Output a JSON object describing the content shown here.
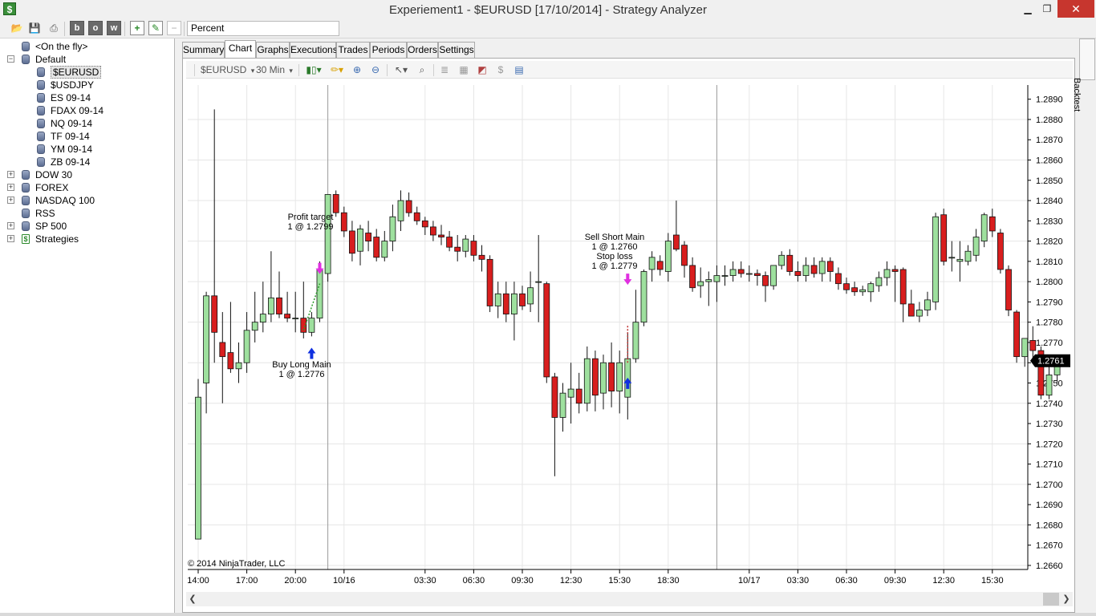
{
  "window": {
    "title": "Experiement1 - $EURUSD [17/10/2014] - Strategy Analyzer",
    "min": "▁",
    "max": "❐",
    "close": "✕"
  },
  "toolbar": {
    "metric": "Percent",
    "icons": [
      "open-folder-icon",
      "save-icon",
      "print-icon",
      "b-icon",
      "o-icon",
      "w-icon",
      "add-icon",
      "edit-icon",
      "remove-icon"
    ],
    "b_label": "b",
    "o_label": "o",
    "w_label": "w"
  },
  "tree": {
    "items": [
      {
        "label": "<On the fly>",
        "level": 1,
        "expander": "",
        "icon": "db"
      },
      {
        "label": "Default",
        "level": 0,
        "expander": "−",
        "icon": "db"
      },
      {
        "label": "$EURUSD",
        "level": 2,
        "expander": "",
        "icon": "db",
        "selected": true
      },
      {
        "label": "$USDJPY",
        "level": 2,
        "expander": "",
        "icon": "db"
      },
      {
        "label": "ES 09-14",
        "level": 2,
        "expander": "",
        "icon": "db"
      },
      {
        "label": "FDAX 09-14",
        "level": 2,
        "expander": "",
        "icon": "db"
      },
      {
        "label": "NQ 09-14",
        "level": 2,
        "expander": "",
        "icon": "db"
      },
      {
        "label": "TF 09-14",
        "level": 2,
        "expander": "",
        "icon": "db"
      },
      {
        "label": "YM 09-14",
        "level": 2,
        "expander": "",
        "icon": "db"
      },
      {
        "label": "ZB 09-14",
        "level": 2,
        "expander": "",
        "icon": "db"
      },
      {
        "label": "DOW 30",
        "level": 0,
        "expander": "+",
        "icon": "db"
      },
      {
        "label": "FOREX",
        "level": 0,
        "expander": "+",
        "icon": "db"
      },
      {
        "label": "NASDAQ 100",
        "level": 0,
        "expander": "+",
        "icon": "db"
      },
      {
        "label": "RSS",
        "level": 1,
        "expander": "",
        "icon": "db"
      },
      {
        "label": "SP 500",
        "level": 0,
        "expander": "+",
        "icon": "db"
      },
      {
        "label": "Strategies",
        "level": 0,
        "expander": "+",
        "icon": "strategy"
      }
    ]
  },
  "tabs": [
    {
      "label": "Summary"
    },
    {
      "label": "Chart",
      "active": true
    },
    {
      "label": "Graphs"
    },
    {
      "label": "Executions"
    },
    {
      "label": "Trades"
    },
    {
      "label": "Periods"
    },
    {
      "label": "Orders"
    },
    {
      "label": "Settings"
    }
  ],
  "chart_toolbar": {
    "instrument": "$EURUSD",
    "period": "30 Min",
    "dropdown_arrow": "▾",
    "icons": [
      "bar-style-icon",
      "drawing-pencil-icon",
      "zoom-in-icon",
      "zoom-out-icon",
      "cursor-icon",
      "find-icon",
      "properties-icon",
      "data-box-icon",
      "chart-trader-icon",
      "dollar-icon",
      "window-icon"
    ]
  },
  "side_tab": {
    "label": "Backtest"
  },
  "chart_data": {
    "type": "candlestick",
    "instrument": "$EURUSD",
    "period": "30 Min",
    "copyright": "© 2014 NinjaTrader, LLC",
    "price_tick_labels": [
      "1.2890",
      "1.2880",
      "1.2870",
      "1.2860",
      "1.2850",
      "1.2840",
      "1.2830",
      "1.2820",
      "1.2810",
      "1.2800",
      "1.2790",
      "1.2780",
      "1.2770",
      "1.2760",
      "1.2750",
      "1.2740",
      "1.2730",
      "1.2720",
      "1.2710",
      "1.2700",
      "1.2690",
      "1.2680",
      "1.2670",
      "1.2660"
    ],
    "y_range": [
      1.2658,
      1.2897
    ],
    "last_price": "1.2761",
    "time_tick_labels": [
      "14:00",
      "17:00",
      "20:00",
      "10/16",
      "03:30",
      "06:30",
      "09:30",
      "12:30",
      "15:30",
      "18:30",
      "10/17",
      "03:30",
      "06:30",
      "09:30",
      "12:30",
      "15:30"
    ],
    "candles": [
      {
        "o": 1.2673,
        "h": 1.2752,
        "l": 1.2673,
        "c": 1.2743
      },
      {
        "o": 1.275,
        "h": 1.2795,
        "l": 1.2735,
        "c": 1.2793
      },
      {
        "o": 1.2793,
        "h": 1.2885,
        "l": 1.276,
        "c": 1.2775
      },
      {
        "o": 1.277,
        "h": 1.2785,
        "l": 1.274,
        "c": 1.2763
      },
      {
        "o": 1.2765,
        "h": 1.279,
        "l": 1.2755,
        "c": 1.2757
      },
      {
        "o": 1.2757,
        "h": 1.277,
        "l": 1.275,
        "c": 1.276
      },
      {
        "o": 1.276,
        "h": 1.2785,
        "l": 1.2755,
        "c": 1.2776
      },
      {
        "o": 1.2776,
        "h": 1.2795,
        "l": 1.277,
        "c": 1.278
      },
      {
        "o": 1.278,
        "h": 1.28,
        "l": 1.2775,
        "c": 1.2784
      },
      {
        "o": 1.2784,
        "h": 1.2815,
        "l": 1.278,
        "c": 1.2792
      },
      {
        "o": 1.2792,
        "h": 1.2805,
        "l": 1.2782,
        "c": 1.2784
      },
      {
        "o": 1.2784,
        "h": 1.2795,
        "l": 1.278,
        "c": 1.2782
      },
      {
        "o": 1.2782,
        "h": 1.2795,
        "l": 1.2775,
        "c": 1.2782
      },
      {
        "o": 1.2782,
        "h": 1.28,
        "l": 1.2772,
        "c": 1.2775
      },
      {
        "o": 1.2775,
        "h": 1.2785,
        "l": 1.2773,
        "c": 1.2782
      },
      {
        "o": 1.2782,
        "h": 1.281,
        "l": 1.278,
        "c": 1.2806
      },
      {
        "o": 1.2804,
        "h": 1.2843,
        "l": 1.28,
        "c": 1.2843
      },
      {
        "o": 1.2843,
        "h": 1.2845,
        "l": 1.2832,
        "c": 1.2834
      },
      {
        "o": 1.2834,
        "h": 1.2837,
        "l": 1.2822,
        "c": 1.2825
      },
      {
        "o": 1.2825,
        "h": 1.283,
        "l": 1.281,
        "c": 1.2814
      },
      {
        "o": 1.2815,
        "h": 1.2828,
        "l": 1.2808,
        "c": 1.2826
      },
      {
        "o": 1.2824,
        "h": 1.283,
        "l": 1.2815,
        "c": 1.282
      },
      {
        "o": 1.2822,
        "h": 1.2826,
        "l": 1.281,
        "c": 1.2812
      },
      {
        "o": 1.2812,
        "h": 1.2825,
        "l": 1.281,
        "c": 1.282
      },
      {
        "o": 1.282,
        "h": 1.2838,
        "l": 1.2815,
        "c": 1.2832
      },
      {
        "o": 1.283,
        "h": 1.2845,
        "l": 1.2825,
        "c": 1.284
      },
      {
        "o": 1.284,
        "h": 1.2844,
        "l": 1.2832,
        "c": 1.2834
      },
      {
        "o": 1.2834,
        "h": 1.2837,
        "l": 1.2828,
        "c": 1.283
      },
      {
        "o": 1.283,
        "h": 1.2832,
        "l": 1.2823,
        "c": 1.2827
      },
      {
        "o": 1.2827,
        "h": 1.283,
        "l": 1.282,
        "c": 1.2823
      },
      {
        "o": 1.2823,
        "h": 1.2828,
        "l": 1.2818,
        "c": 1.2822
      },
      {
        "o": 1.2822,
        "h": 1.2825,
        "l": 1.2815,
        "c": 1.2817
      },
      {
        "o": 1.2817,
        "h": 1.2823,
        "l": 1.281,
        "c": 1.2815
      },
      {
        "o": 1.2815,
        "h": 1.2823,
        "l": 1.2812,
        "c": 1.2821
      },
      {
        "o": 1.282,
        "h": 1.2823,
        "l": 1.281,
        "c": 1.2813
      },
      {
        "o": 1.2813,
        "h": 1.2818,
        "l": 1.2805,
        "c": 1.2811
      },
      {
        "o": 1.2811,
        "h": 1.2813,
        "l": 1.2785,
        "c": 1.2788
      },
      {
        "o": 1.2788,
        "h": 1.28,
        "l": 1.2782,
        "c": 1.2794
      },
      {
        "o": 1.2794,
        "h": 1.28,
        "l": 1.278,
        "c": 1.2784
      },
      {
        "o": 1.2784,
        "h": 1.28,
        "l": 1.2771,
        "c": 1.2794
      },
      {
        "o": 1.2794,
        "h": 1.2798,
        "l": 1.2786,
        "c": 1.2788
      },
      {
        "o": 1.2789,
        "h": 1.2805,
        "l": 1.2785,
        "c": 1.2797
      },
      {
        "o": 1.28,
        "h": 1.2823,
        "l": 1.278,
        "c": 1.28
      },
      {
        "o": 1.2799,
        "h": 1.28,
        "l": 1.275,
        "c": 1.2753
      },
      {
        "o": 1.2753,
        "h": 1.2755,
        "l": 1.2704,
        "c": 1.2733
      },
      {
        "o": 1.2733,
        "h": 1.275,
        "l": 1.2726,
        "c": 1.2745
      },
      {
        "o": 1.2743,
        "h": 1.276,
        "l": 1.273,
        "c": 1.2747
      },
      {
        "o": 1.2747,
        "h": 1.2755,
        "l": 1.2735,
        "c": 1.274
      },
      {
        "o": 1.274,
        "h": 1.2768,
        "l": 1.2736,
        "c": 1.2762
      },
      {
        "o": 1.2762,
        "h": 1.2766,
        "l": 1.2736,
        "c": 1.2744
      },
      {
        "o": 1.2745,
        "h": 1.2764,
        "l": 1.2737,
        "c": 1.276
      },
      {
        "o": 1.276,
        "h": 1.277,
        "l": 1.2738,
        "c": 1.2746
      },
      {
        "o": 1.2746,
        "h": 1.2766,
        "l": 1.2735,
        "c": 1.276
      },
      {
        "o": 1.2743,
        "h": 1.2775,
        "l": 1.2732,
        "c": 1.2762
      },
      {
        "o": 1.2762,
        "h": 1.2796,
        "l": 1.276,
        "c": 1.278
      },
      {
        "o": 1.278,
        "h": 1.2806,
        "l": 1.2778,
        "c": 1.2805
      },
      {
        "o": 1.2806,
        "h": 1.2815,
        "l": 1.28,
        "c": 1.2812
      },
      {
        "o": 1.281,
        "h": 1.2813,
        "l": 1.2803,
        "c": 1.2806
      },
      {
        "o": 1.2805,
        "h": 1.2824,
        "l": 1.28,
        "c": 1.282
      },
      {
        "o": 1.2823,
        "h": 1.284,
        "l": 1.2815,
        "c": 1.2816
      },
      {
        "o": 1.2818,
        "h": 1.282,
        "l": 1.2802,
        "c": 1.2808
      },
      {
        "o": 1.2808,
        "h": 1.2812,
        "l": 1.2795,
        "c": 1.2797
      },
      {
        "o": 1.2798,
        "h": 1.2807,
        "l": 1.2792,
        "c": 1.28
      },
      {
        "o": 1.28,
        "h": 1.2805,
        "l": 1.2788,
        "c": 1.2801
      },
      {
        "o": 1.28,
        "h": 1.2808,
        "l": 1.279,
        "c": 1.2803
      },
      {
        "o": 1.2803,
        "h": 1.2808,
        "l": 1.2798,
        "c": 1.2803
      },
      {
        "o": 1.2803,
        "h": 1.281,
        "l": 1.28,
        "c": 1.2806
      },
      {
        "o": 1.2806,
        "h": 1.281,
        "l": 1.2802,
        "c": 1.2804
      },
      {
        "o": 1.2804,
        "h": 1.2808,
        "l": 1.28,
        "c": 1.2804
      },
      {
        "o": 1.2804,
        "h": 1.2806,
        "l": 1.2798,
        "c": 1.2803
      },
      {
        "o": 1.2803,
        "h": 1.2805,
        "l": 1.279,
        "c": 1.2798
      },
      {
        "o": 1.2798,
        "h": 1.2808,
        "l": 1.2796,
        "c": 1.2808
      },
      {
        "o": 1.2808,
        "h": 1.2815,
        "l": 1.2806,
        "c": 1.2813
      },
      {
        "o": 1.2813,
        "h": 1.2816,
        "l": 1.2803,
        "c": 1.2805
      },
      {
        "o": 1.2805,
        "h": 1.281,
        "l": 1.28,
        "c": 1.2803
      },
      {
        "o": 1.2803,
        "h": 1.2812,
        "l": 1.28,
        "c": 1.2808
      },
      {
        "o": 1.2808,
        "h": 1.2812,
        "l": 1.2802,
        "c": 1.2804
      },
      {
        "o": 1.2804,
        "h": 1.2812,
        "l": 1.28,
        "c": 1.281
      },
      {
        "o": 1.281,
        "h": 1.2812,
        "l": 1.28,
        "c": 1.2805
      },
      {
        "o": 1.2804,
        "h": 1.2807,
        "l": 1.2796,
        "c": 1.2799
      },
      {
        "o": 1.2799,
        "h": 1.2802,
        "l": 1.2794,
        "c": 1.2796
      },
      {
        "o": 1.2797,
        "h": 1.28,
        "l": 1.2793,
        "c": 1.2795
      },
      {
        "o": 1.2795,
        "h": 1.2798,
        "l": 1.2793,
        "c": 1.2796
      },
      {
        "o": 1.2795,
        "h": 1.28,
        "l": 1.279,
        "c": 1.2799
      },
      {
        "o": 1.2798,
        "h": 1.2805,
        "l": 1.2795,
        "c": 1.2802
      },
      {
        "o": 1.2802,
        "h": 1.281,
        "l": 1.2798,
        "c": 1.2806
      },
      {
        "o": 1.2806,
        "h": 1.2808,
        "l": 1.279,
        "c": 1.2805
      },
      {
        "o": 1.2806,
        "h": 1.2807,
        "l": 1.278,
        "c": 1.2789
      },
      {
        "o": 1.2789,
        "h": 1.2796,
        "l": 1.2783,
        "c": 1.2783
      },
      {
        "o": 1.2783,
        "h": 1.279,
        "l": 1.278,
        "c": 1.2786
      },
      {
        "o": 1.2786,
        "h": 1.2795,
        "l": 1.2783,
        "c": 1.2791
      },
      {
        "o": 1.279,
        "h": 1.2834,
        "l": 1.2786,
        "c": 1.2832
      },
      {
        "o": 1.2833,
        "h": 1.2836,
        "l": 1.2808,
        "c": 1.281
      },
      {
        "o": 1.2812,
        "h": 1.282,
        "l": 1.2805,
        "c": 1.2812
      },
      {
        "o": 1.281,
        "h": 1.282,
        "l": 1.28,
        "c": 1.2811
      },
      {
        "o": 1.281,
        "h": 1.2818,
        "l": 1.2808,
        "c": 1.2815
      },
      {
        "o": 1.2813,
        "h": 1.2826,
        "l": 1.281,
        "c": 1.2822
      },
      {
        "o": 1.282,
        "h": 1.2834,
        "l": 1.2817,
        "c": 1.2833
      },
      {
        "o": 1.2832,
        "h": 1.2836,
        "l": 1.2822,
        "c": 1.2825
      },
      {
        "o": 1.2824,
        "h": 1.2826,
        "l": 1.2804,
        "c": 1.2806
      },
      {
        "o": 1.2806,
        "h": 1.2808,
        "l": 1.2783,
        "c": 1.2786
      },
      {
        "o": 1.2785,
        "h": 1.2786,
        "l": 1.276,
        "c": 1.2763
      },
      {
        "o": 1.2763,
        "h": 1.2772,
        "l": 1.2758,
        "c": 1.2772
      },
      {
        "o": 1.2771,
        "h": 1.2778,
        "l": 1.2762,
        "c": 1.2766
      },
      {
        "o": 1.2766,
        "h": 1.2768,
        "l": 1.2742,
        "c": 1.2744
      },
      {
        "o": 1.2744,
        "h": 1.2758,
        "l": 1.2742,
        "c": 1.2754
      },
      {
        "o": 1.2754,
        "h": 1.2764,
        "l": 1.275,
        "c": 1.2761
      }
    ],
    "annotations": [
      {
        "lines": [
          "Profit target",
          "1 @ 1.2799"
        ],
        "kind": "exit"
      },
      {
        "lines": [
          "Buy Long Main",
          "1 @ 1.2776"
        ],
        "kind": "entry-long"
      },
      {
        "lines": [
          "Sell Short Main",
          "1 @ 1.2760",
          "Stop loss",
          "1 @ 1.2779"
        ],
        "kind": "short-and-stop"
      }
    ],
    "colors": {
      "up_candle": "#9ee09e",
      "down_candle": "#d81e1e",
      "outline": "#111111",
      "grid": "#e6e6e6",
      "session_line": "#9a9a9a",
      "entry_arrow": "#1030e0",
      "exit_arrow": "#e030e0"
    }
  }
}
